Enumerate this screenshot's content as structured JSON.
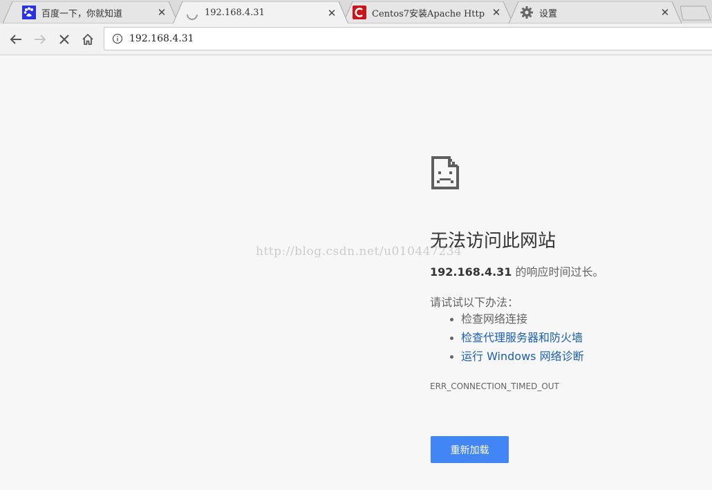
{
  "tabs": [
    {
      "title": "百度一下，你就知道",
      "favicon": "baidu-paw-icon",
      "active": false
    },
    {
      "title": "192.168.4.31",
      "favicon": "loading-spinner-icon",
      "active": true
    },
    {
      "title": "Centos7安装Apache Http",
      "favicon": "csdn-logo-icon",
      "active": false
    },
    {
      "title": "设置",
      "favicon": "gear-icon",
      "active": false
    }
  ],
  "toolbar": {
    "url": "192.168.4.31"
  },
  "error_page": {
    "heading": "无法访问此网站",
    "host": "192.168.4.31",
    "summary_suffix": " 的响应时间过长。",
    "suggestions_title": "请试试以下办法：",
    "suggestions": [
      {
        "text": "检查网络连接",
        "link": false
      },
      {
        "text": "检查代理服务器和防火墙",
        "link": true
      },
      {
        "text": "运行 Windows 网络诊断",
        "link": true
      }
    ],
    "error_code": "ERR_CONNECTION_TIMED_OUT",
    "reload_label": "重新加载"
  },
  "watermark": "http://blog.csdn.net/u010447234",
  "colors": {
    "page_bg": "#f7f7f7",
    "tabstrip_bg": "#dcdcdc",
    "link": "#1a5fb4",
    "button_bg": "#4285f4",
    "baidu_blue": "#2932e1",
    "csdn_red": "#c9141c"
  }
}
